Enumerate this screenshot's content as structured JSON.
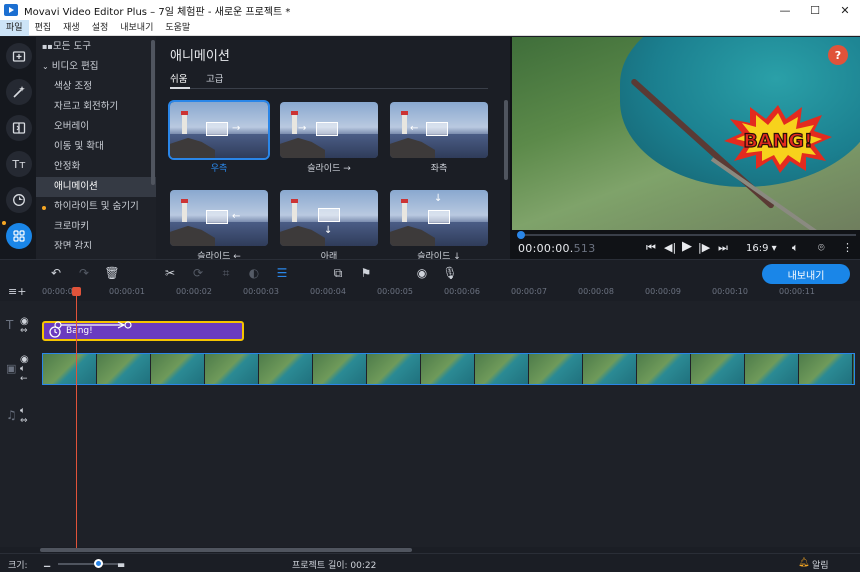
{
  "window": {
    "title": "Movavi Video Editor Plus – 7일 체험판 - 새로운 프로젝트 *",
    "minimize": "—",
    "maximize": "☐",
    "close": "✕"
  },
  "menu": [
    "파일",
    "편집",
    "재생",
    "설정",
    "내보내기",
    "도움말"
  ],
  "tools": [
    {
      "icon": "import-icon"
    },
    {
      "icon": "magic-wand-icon"
    },
    {
      "icon": "transitions-icon"
    },
    {
      "icon": "titles-icon",
      "glyph": "Tт"
    },
    {
      "icon": "stickers-icon"
    },
    {
      "icon": "more-tools-icon"
    }
  ],
  "tree": [
    "모든 도구",
    "비디오 편집",
    "색상 조정",
    "자르고 회전하기",
    "오버레이",
    "이동 및 확대",
    "안정화",
    "애니메이션",
    "하이라이트 및 숨기기",
    "크로마키",
    "장면 감지"
  ],
  "library": {
    "title": "애니메이션",
    "tabs": [
      "쉬움",
      "고급"
    ],
    "cards": [
      {
        "label": "우측",
        "arrow": "→"
      },
      {
        "label": "슬라이드 →",
        "arrow": "→"
      },
      {
        "label": "좌측",
        "arrow": "←"
      },
      {
        "label": "슬라이드 ←",
        "arrow": "←"
      },
      {
        "label": "아래",
        "arrow": "↓"
      },
      {
        "label": "슬라이드 ↓",
        "arrow": "↓"
      }
    ]
  },
  "preview": {
    "help": "?",
    "overlay_text": "BANG!",
    "timecode_main": "00:00:00.",
    "timecode_frac": "513",
    "aspect": "16:9 ▾",
    "progress": 0.0
  },
  "timeline": {
    "export_label": "내보내기",
    "ticks": [
      "00:00:00",
      "00:00:01",
      "00:00:02",
      "00:00:03",
      "00:00:04",
      "00:00:05",
      "00:00:06",
      "00:00:07",
      "00:00:08",
      "00:00:09",
      "00:00:10",
      "00:00:11"
    ],
    "title_clip": "Bang!"
  },
  "status": {
    "zoom_label": "크기:",
    "project_length": "프로젝트 길이: 00:22",
    "notifications": "알림"
  },
  "colors": {
    "accent": "#1a86e8",
    "title_clip": "#6a3bbf",
    "title_border": "#f5c400",
    "playhead": "#e0533a",
    "highlight_dot": "#f5a623"
  }
}
